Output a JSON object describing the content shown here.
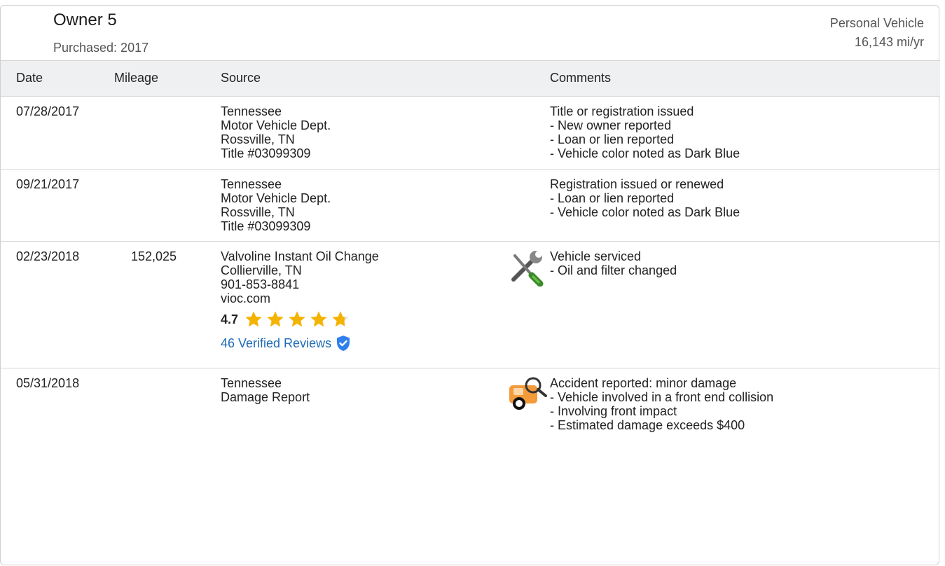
{
  "owner": {
    "title": "Owner 5",
    "purchased": "Purchased: 2017",
    "usage_type": "Personal Vehicle",
    "mileage_rate": "16,143 mi/yr"
  },
  "columns": {
    "date": "Date",
    "mileage": "Mileage",
    "source": "Source",
    "comments": "Comments"
  },
  "records": [
    {
      "date": "07/28/2017",
      "mileage": "",
      "source": [
        "Tennessee",
        "Motor Vehicle Dept.",
        "Rossville, TN",
        "Title #03099309"
      ],
      "comment_title": "Title or registration issued",
      "comments": [
        "- New owner reported",
        "- Loan or lien reported",
        "- Vehicle color noted as Dark Blue"
      ]
    },
    {
      "date": "09/21/2017",
      "mileage": "",
      "source": [
        "Tennessee",
        "Motor Vehicle Dept.",
        "Rossville, TN",
        "Title #03099309"
      ],
      "comment_title": "Registration issued or renewed",
      "comments": [
        "- Loan or lien reported",
        "- Vehicle color noted as Dark Blue"
      ]
    },
    {
      "date": "02/23/2018",
      "mileage": "152,025",
      "source": [
        "Valvoline Instant Oil Change",
        "Collierville, TN",
        "901-853-8841",
        "vioc.com"
      ],
      "rating": "4.7",
      "rating_fraction": 0.94,
      "reviews_label": "46 Verified Reviews",
      "icon": "wrench-screwdriver-icon",
      "comment_title": "Vehicle serviced",
      "comments": [
        "- Oil and filter changed"
      ]
    },
    {
      "date": "05/31/2018",
      "mileage": "",
      "source": [
        "Tennessee",
        "Damage Report"
      ],
      "icon": "damage-magnifier-icon",
      "comment_title": "Accident reported: minor damage",
      "comments": [
        "- Vehicle involved in a front end collision",
        "- Involving front impact",
        "- Estimated damage exceeds $400"
      ]
    }
  ],
  "colors": {
    "star": "#f5b301",
    "link": "#1f6bb5",
    "verified": "#2f80ed",
    "header_bg": "#eef0f2"
  }
}
